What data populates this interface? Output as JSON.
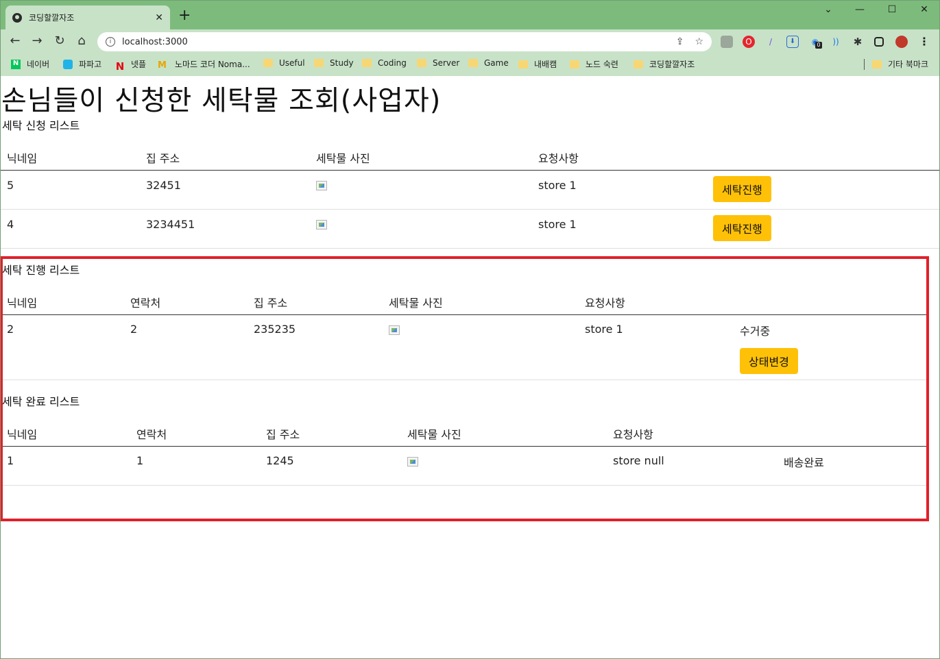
{
  "browser": {
    "tab_title": "코딩할깔자조",
    "url": "localhost:3000",
    "bookmarks": [
      "네이버",
      "파파고",
      "넷플",
      "노마드 코더 Noma...",
      "Useful",
      "Study",
      "Coding",
      "Server",
      "Game",
      "내배캠",
      "노드 숙련",
      "코딩할깔자조"
    ],
    "other_bookmarks": "기타 북마크",
    "extension_badge": "0"
  },
  "page": {
    "title": "손님들이 신청한 세탁물 조회(사업자)",
    "request_list": {
      "title": "세탁 신청 리스트",
      "headers": [
        "닉네임",
        "집 주소",
        "세탁물 사진",
        "요청사항"
      ],
      "rows": [
        {
          "nickname": "5",
          "address": "32451",
          "request": "store 1",
          "action": "세탁진행"
        },
        {
          "nickname": "4",
          "address": "3234451",
          "request": "store 1",
          "action": "세탁진행"
        }
      ]
    },
    "progress_list": {
      "title": "세탁 진행 리스트",
      "headers": [
        "닉네임",
        "연락처",
        "집 주소",
        "세탁물 사진",
        "요청사항"
      ],
      "rows": [
        {
          "nickname": "2",
          "contact": "2",
          "address": "235235",
          "request": "store 1",
          "status": "수거중",
          "action": "상태변경"
        }
      ]
    },
    "done_list": {
      "title": "세탁 완료 리스트",
      "headers": [
        "닉네임",
        "연락처",
        "집 주소",
        "세탁물 사진",
        "요청사항"
      ],
      "rows": [
        {
          "nickname": "1",
          "contact": "1",
          "address": "1245",
          "request": "store null",
          "status": "배송완료"
        }
      ]
    },
    "highlight_color": "#e0202a",
    "button_color": "#ffc107"
  }
}
